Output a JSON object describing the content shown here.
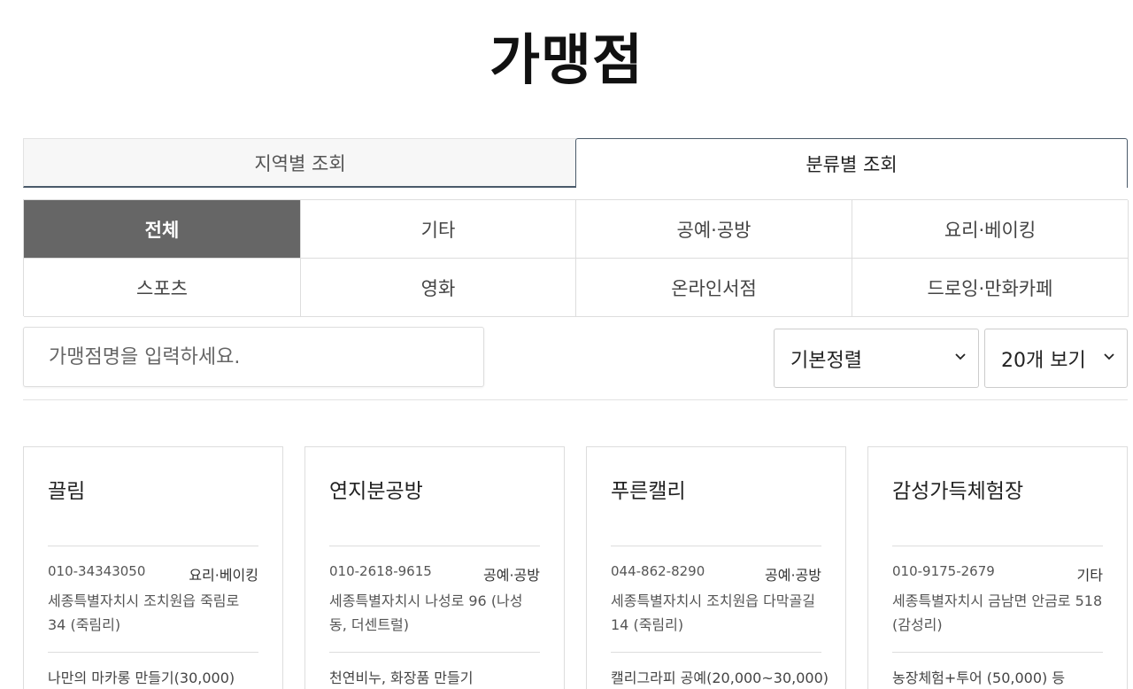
{
  "page": {
    "title": "가맹점"
  },
  "view_tabs": [
    {
      "label": "지역별 조회",
      "active": false
    },
    {
      "label": "분류별 조회",
      "active": true
    }
  ],
  "categories": [
    {
      "label": "전체",
      "active": true
    },
    {
      "label": "기타",
      "active": false
    },
    {
      "label": "공예·공방",
      "active": false
    },
    {
      "label": "요리·베이킹",
      "active": false
    },
    {
      "label": "스포츠",
      "active": false
    },
    {
      "label": "영화",
      "active": false
    },
    {
      "label": "온라인서점",
      "active": false
    },
    {
      "label": "드로잉·만화카페",
      "active": false
    }
  ],
  "search": {
    "placeholder": "가맹점명을 입력하세요.",
    "value": ""
  },
  "sort_select": {
    "value": "기본정렬"
  },
  "count_select": {
    "value": "20개 보기"
  },
  "stores": [
    {
      "name": "끌림",
      "phone": "010-34343050",
      "category": "요리·베이킹",
      "address": "세종특별자치시 조치원읍 죽림로 34 (죽림리)",
      "description": "나만의 마카롱 만들기(30,000)"
    },
    {
      "name": "연지분공방",
      "phone": "010-2618-9615",
      "category": "공예·공방",
      "address": "세종특별자치시 나성로 96 (나성동, 더센트럴)",
      "description": "천연비누, 화장품 만들기"
    },
    {
      "name": "푸른캘리",
      "phone": "044-862-8290",
      "category": "공예·공방",
      "address": "세종특별자치시 조치원읍 다막골길 14 (죽림리)",
      "description": "캘리그라피 공예(20,000~30,000)"
    },
    {
      "name": "감성가득체험장",
      "phone": "010-9175-2679",
      "category": "기타",
      "address": "세종특별자치시 금남면 안금로 518 (감성리)",
      "description": "농장체험+투어 (50,000) 등"
    }
  ]
}
